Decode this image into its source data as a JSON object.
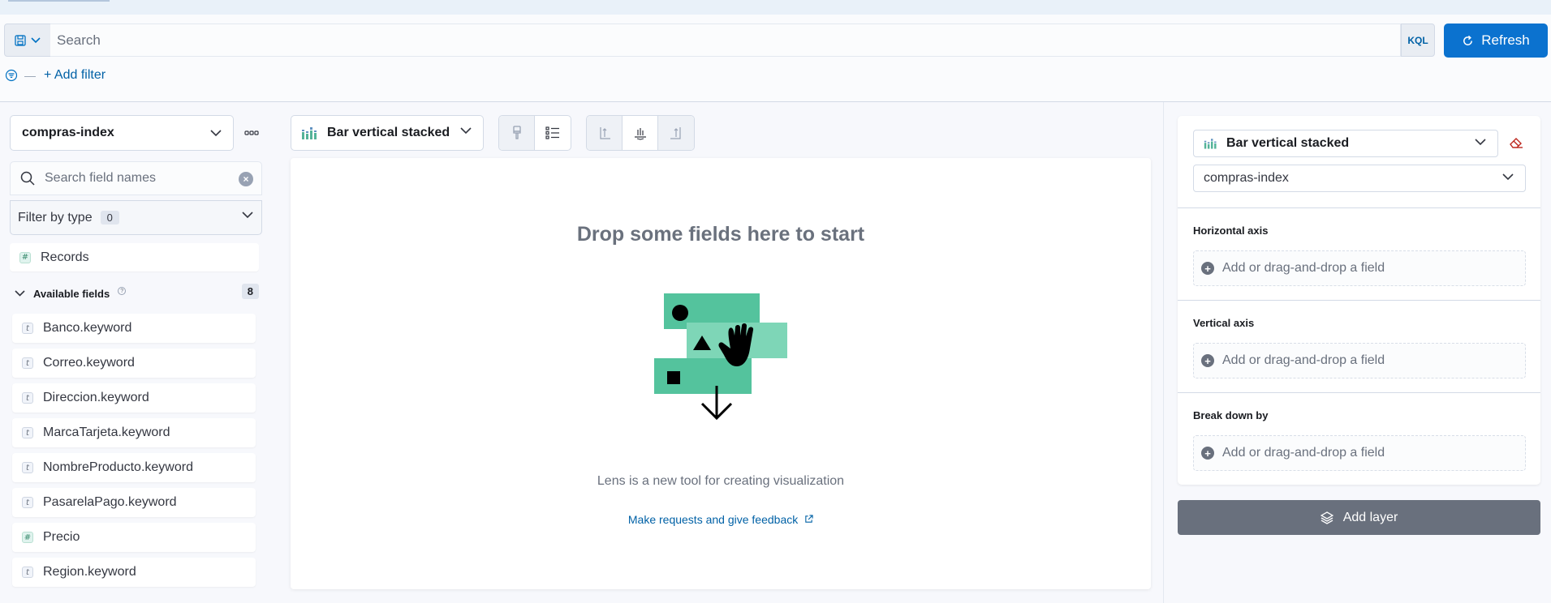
{
  "query": {
    "search_placeholder": "Search",
    "language": "KQL",
    "refresh_label": "Refresh",
    "add_filter_label": "+ Add filter"
  },
  "sidebar": {
    "index_pattern": "compras-index",
    "field_search_placeholder": "Search field names",
    "filter_by_type_label": "Filter by type",
    "filter_by_type_count": "0",
    "records_label": "Records",
    "available_fields_label": "Available fields",
    "available_fields_count": "8",
    "fields": [
      {
        "name": "Banco.keyword",
        "type": "t"
      },
      {
        "name": "Correo.keyword",
        "type": "t"
      },
      {
        "name": "Direccion.keyword",
        "type": "t"
      },
      {
        "name": "MarcaTarjeta.keyword",
        "type": "t"
      },
      {
        "name": "NombreProducto.keyword",
        "type": "t"
      },
      {
        "name": "PasarelaPago.keyword",
        "type": "t"
      },
      {
        "name": "Precio",
        "type": "#"
      },
      {
        "name": "Region.keyword",
        "type": "t"
      }
    ]
  },
  "toolbar": {
    "chart_type": "Bar vertical stacked"
  },
  "workspace": {
    "title": "Drop some fields here to start",
    "subtitle": "Lens is a new tool for creating visualization",
    "feedback_link": "Make requests and give feedback"
  },
  "config": {
    "layer_chart_type": "Bar vertical stacked",
    "datasource": "compras-index",
    "sections": [
      {
        "label": "Horizontal axis",
        "placeholder": "Add or drag-and-drop a field"
      },
      {
        "label": "Vertical axis",
        "placeholder": "Add or drag-and-drop a field"
      },
      {
        "label": "Break down by",
        "placeholder": "Add or drag-and-drop a field"
      }
    ],
    "add_layer_label": "Add layer"
  },
  "colors": {
    "primary": "#0b72cf",
    "link": "#0061a6",
    "illustration_green": "#54c39d",
    "illustration_light_green": "#7ed6b7",
    "danger": "#bd271e"
  }
}
